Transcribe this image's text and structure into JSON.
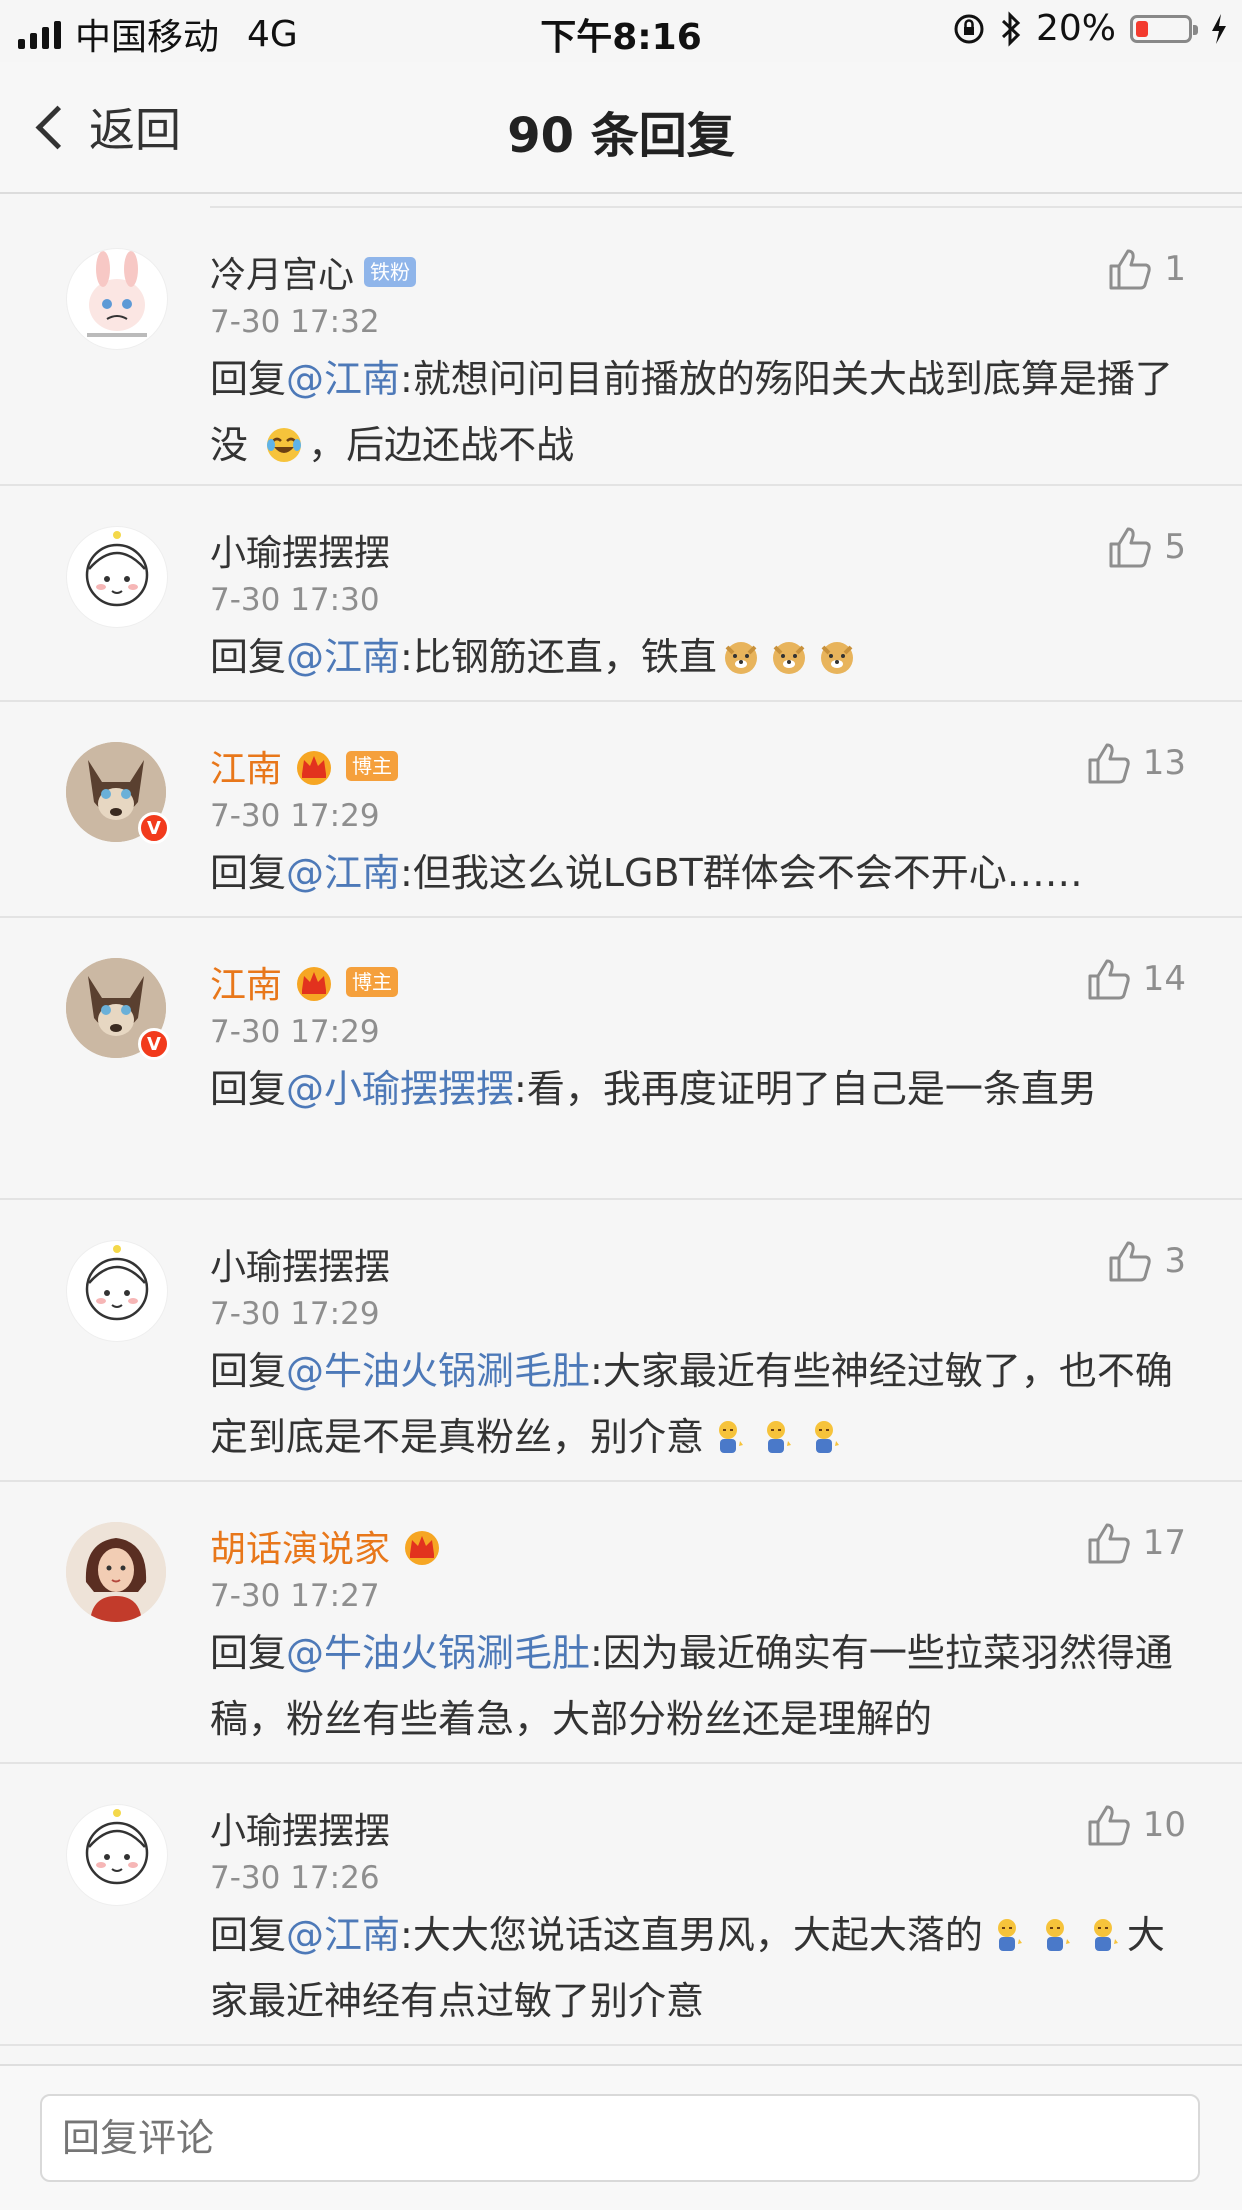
{
  "status_bar": {
    "carrier": "中国移动",
    "network": "4G",
    "time": "下午8:16",
    "battery": "20%"
  },
  "nav": {
    "back_label": "返回",
    "title": "90 条回复"
  },
  "comments": [
    {
      "name": "冷月宫心",
      "name_color": "#333333",
      "tag": "铁粉",
      "time": "7-30 17:32",
      "likes": "1",
      "reply_prefix": "回复",
      "mention": "@江南",
      "body": ":就想问问目前播放的殇阳关大战到底算是播了没",
      "body_tail": "，后边还战不战",
      "emoji": "laughing-crying-emoji"
    },
    {
      "name": "小瑜摆摆摆",
      "time": "7-30 17:30",
      "likes": "5",
      "reply_prefix": "回复",
      "mention": "@江南",
      "body": ":比钢筋还直，铁直",
      "emoji": "doge-emoji"
    },
    {
      "name": "江南",
      "name_color": "#e8771a",
      "tag": "博主",
      "time": "7-30 17:29",
      "likes": "13",
      "reply_prefix": "回复",
      "mention": "@江南",
      "body": ":但我这么说LGBT群体会不会不开心……"
    },
    {
      "name": "江南",
      "name_color": "#e8771a",
      "tag": "博主",
      "time": "7-30 17:29",
      "likes": "14",
      "reply_prefix": "回复",
      "mention": "@小瑜摆摆摆",
      "body": ":看，我再度证明了自己是一条直男"
    },
    {
      "name": "小瑜摆摆摆",
      "time": "7-30 17:29",
      "likes": "3",
      "reply_prefix": "回复",
      "mention": "@牛油火锅涮毛肚",
      "body": ":大家最近有些神经过敏了，也不确定到底是不是真粉丝，别介意",
      "emoji": "pray-emoji"
    },
    {
      "name": "胡话演说家",
      "name_color": "#e8771a",
      "time": "7-30 17:27",
      "likes": "17",
      "reply_prefix": "回复",
      "mention": "@牛油火锅涮毛肚",
      "body": ":因为最近确实有一些拉菜羽然得通稿，粉丝有些着急，大部分粉丝还是理解的"
    },
    {
      "name": "小瑜摆摆摆",
      "time": "7-30 17:26",
      "likes": "10",
      "reply_prefix": "回复",
      "mention": "@江南",
      "body": ":大大您说话这直男风，大起大落的",
      "body_tail": "大家最近神经有点过敏了别介意",
      "emoji": "pray-emoji"
    }
  ],
  "reply_input": {
    "placeholder": "回复评论"
  },
  "colors": {
    "mention": "#4d79b8",
    "vip_name": "#e8771a",
    "meta": "#8e8e8e"
  }
}
